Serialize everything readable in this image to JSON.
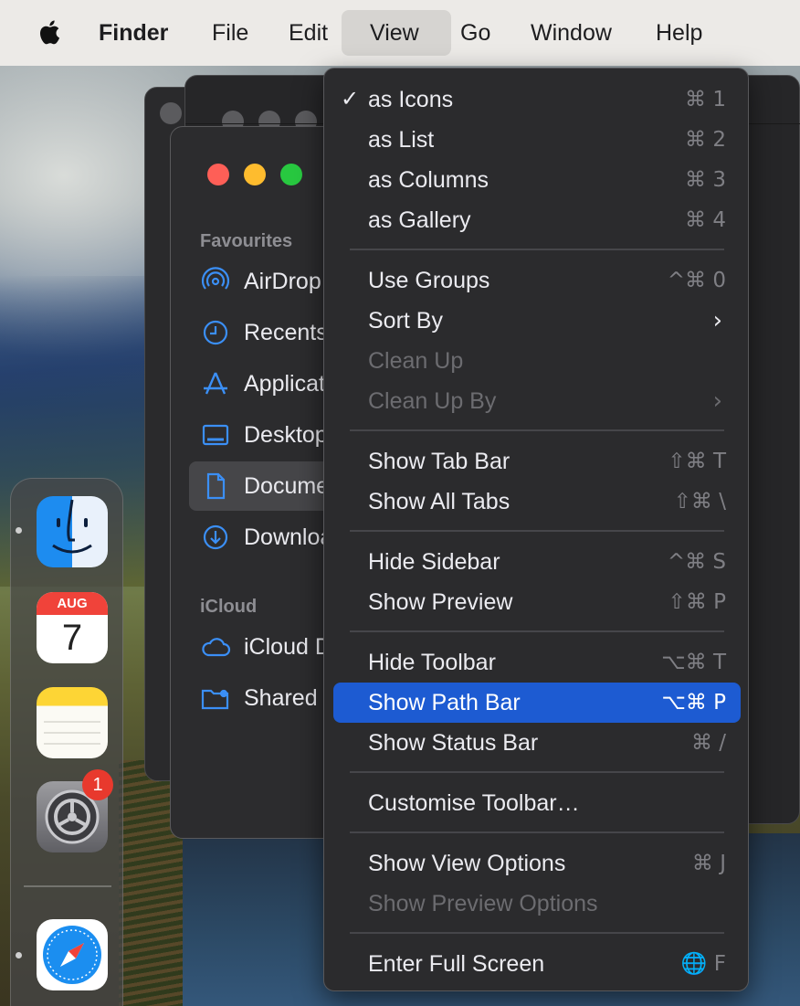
{
  "menubar": {
    "apple_icon": "apple-logo-icon",
    "items": [
      "Finder",
      "File",
      "Edit",
      "View",
      "Go",
      "Window",
      "Help"
    ]
  },
  "finder_sidebar": {
    "favourites_heading": "Favourites",
    "icloud_heading": "iCloud",
    "items": [
      {
        "label": "AirDrop",
        "icon": "airdrop-icon"
      },
      {
        "label": "Recents",
        "icon": "clock-icon"
      },
      {
        "label": "Applications",
        "icon": "applications-icon"
      },
      {
        "label": "Desktop",
        "icon": "desktop-icon"
      },
      {
        "label": "Documents",
        "icon": "document-icon"
      },
      {
        "label": "Downloads",
        "icon": "download-icon"
      },
      {
        "label": "iCloud Drive",
        "icon": "cloud-icon"
      },
      {
        "label": "Shared",
        "icon": "shared-folder-icon"
      }
    ]
  },
  "dock": {
    "apps": [
      "Finder",
      "Calendar",
      "Notes",
      "System Settings",
      "Safari"
    ],
    "calendar_month": "AUG",
    "calendar_day": "7",
    "settings_badge": "1"
  },
  "view_menu": {
    "items": [
      {
        "label": "as Icons",
        "shortcut": "⌘ 1",
        "checked": true
      },
      {
        "label": "as List",
        "shortcut": "⌘ 2"
      },
      {
        "label": "as Columns",
        "shortcut": "⌘ 3"
      },
      {
        "label": "as Gallery",
        "shortcut": "⌘ 4"
      },
      {
        "label": "Use Groups",
        "shortcut": "^⌘ 0"
      },
      {
        "label": "Sort By",
        "submenu": true
      },
      {
        "label": "Clean Up",
        "disabled": true
      },
      {
        "label": "Clean Up By",
        "disabled": true,
        "submenu": true
      },
      {
        "label": "Show Tab Bar",
        "shortcut": "⇧⌘ T"
      },
      {
        "label": "Show All Tabs",
        "shortcut": "⇧⌘ \\"
      },
      {
        "label": "Hide Sidebar",
        "shortcut": "^⌘ S"
      },
      {
        "label": "Show Preview",
        "shortcut": "⇧⌘ P"
      },
      {
        "label": "Hide Toolbar",
        "shortcut": "⌥⌘ T"
      },
      {
        "label": "Show Path Bar",
        "shortcut": "⌥⌘ P",
        "highlighted": true
      },
      {
        "label": "Show Status Bar",
        "shortcut": "⌘ /"
      },
      {
        "label": "Customise Toolbar…"
      },
      {
        "label": "Show View Options",
        "shortcut": "⌘ J"
      },
      {
        "label": "Show Preview Options",
        "disabled": true
      },
      {
        "label": "Enter Full Screen",
        "shortcut": "🌐 F"
      }
    ]
  },
  "colors": {
    "menu_highlight": "#1d5bd2",
    "sidebar_icon": "#3b8ff6",
    "traffic_close": "#fe5f57",
    "traffic_minimize": "#febc2e",
    "traffic_zoom": "#28c840"
  }
}
